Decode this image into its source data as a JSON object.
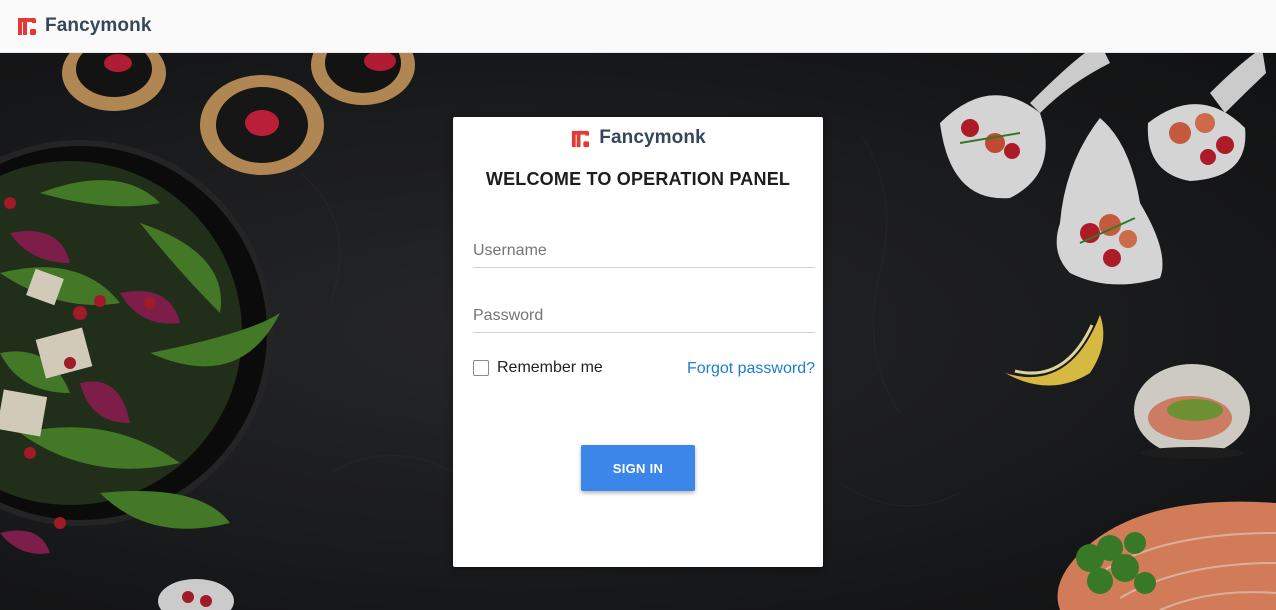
{
  "header": {
    "brand_name": "Fancymonk"
  },
  "card": {
    "brand_name": "Fancymonk",
    "title": "WELCOME TO OPERATION PANEL",
    "username_placeholder": "Username",
    "password_placeholder": "Password",
    "remember_label": "Remember me",
    "forgot_label": "Forgot password?",
    "signin_label": "SIGN IN"
  },
  "colors": {
    "brand_red": "#e53935",
    "brand_text": "#37475a",
    "link_blue": "#1a7ed4",
    "button_blue": "#3b86e8"
  },
  "icons": {
    "logo": "fancymonk-logo-icon"
  }
}
